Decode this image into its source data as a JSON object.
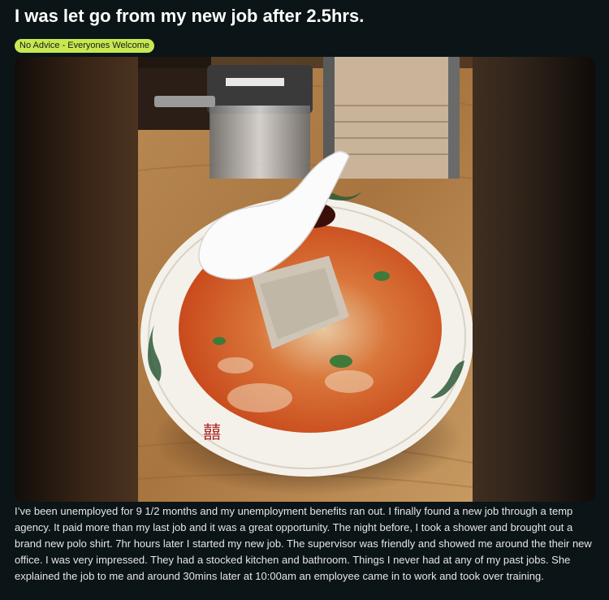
{
  "post": {
    "title": "I was let go from my new job after 2.5hrs.",
    "flair": "No Advice - Everyones Welcome",
    "image": {
      "subject": "ramen-bowl-photo"
    },
    "body": "I’ve been unemployed for 9 1/2 months and my unemployment benefits ran out. I finally found a new job through a temp agency. It paid more than my last job and it was a great opportunity. The night before, I took a shower and brought out a brand new polo shirt. 7hr hours later I started my new job. The supervisor was friendly and showed me around the their new office. I was very impressed. They had a stocked kitchen and bathroom. Things I never had at any of my past jobs. She explained the job to me and around 30mins later at 10:00am an employee came in to work and took over training."
  },
  "colors": {
    "background": "#0b1416",
    "flair_bg": "#c7e850",
    "text": "#e6e6e6"
  }
}
